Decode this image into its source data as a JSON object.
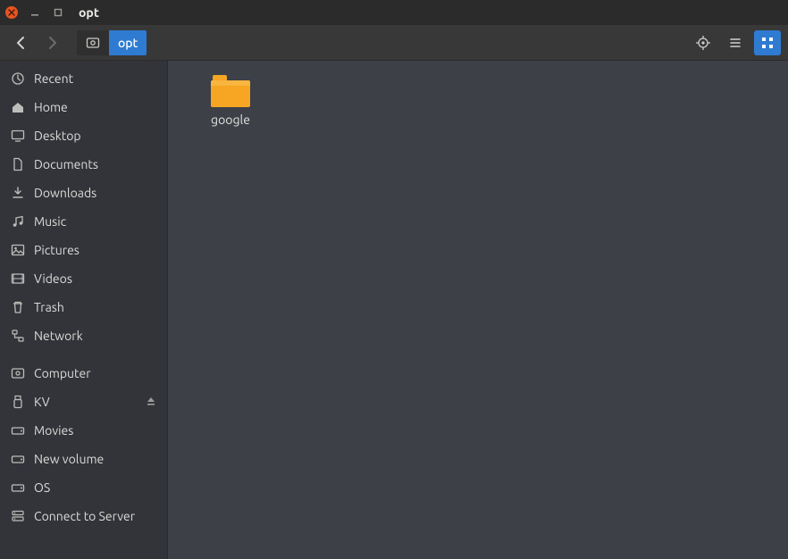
{
  "window": {
    "title": "opt"
  },
  "path": {
    "disk_icon": "disk",
    "current": "opt"
  },
  "toolbar": {
    "back_enabled": true,
    "forward_enabled": false,
    "location_btn": "location",
    "list_btn": "list-view",
    "grid_btn": "grid-view",
    "grid_active": true
  },
  "sidebar": {
    "places": [
      {
        "icon": "recent",
        "label": "Recent"
      },
      {
        "icon": "home",
        "label": "Home"
      },
      {
        "icon": "desktop",
        "label": "Desktop"
      },
      {
        "icon": "documents",
        "label": "Documents"
      },
      {
        "icon": "downloads",
        "label": "Downloads"
      },
      {
        "icon": "music",
        "label": "Music"
      },
      {
        "icon": "pictures",
        "label": "Pictures"
      },
      {
        "icon": "videos",
        "label": "Videos"
      },
      {
        "icon": "trash",
        "label": "Trash"
      },
      {
        "icon": "network",
        "label": "Network"
      }
    ],
    "devices": [
      {
        "icon": "computer",
        "label": "Computer"
      },
      {
        "icon": "usb",
        "label": "KV",
        "eject": true
      },
      {
        "icon": "drive",
        "label": "Movies"
      },
      {
        "icon": "drive",
        "label": "New volume"
      },
      {
        "icon": "drive",
        "label": "OS"
      },
      {
        "icon": "server",
        "label": "Connect to Server"
      }
    ]
  },
  "content": {
    "items": [
      {
        "type": "folder",
        "name": "google"
      }
    ]
  }
}
